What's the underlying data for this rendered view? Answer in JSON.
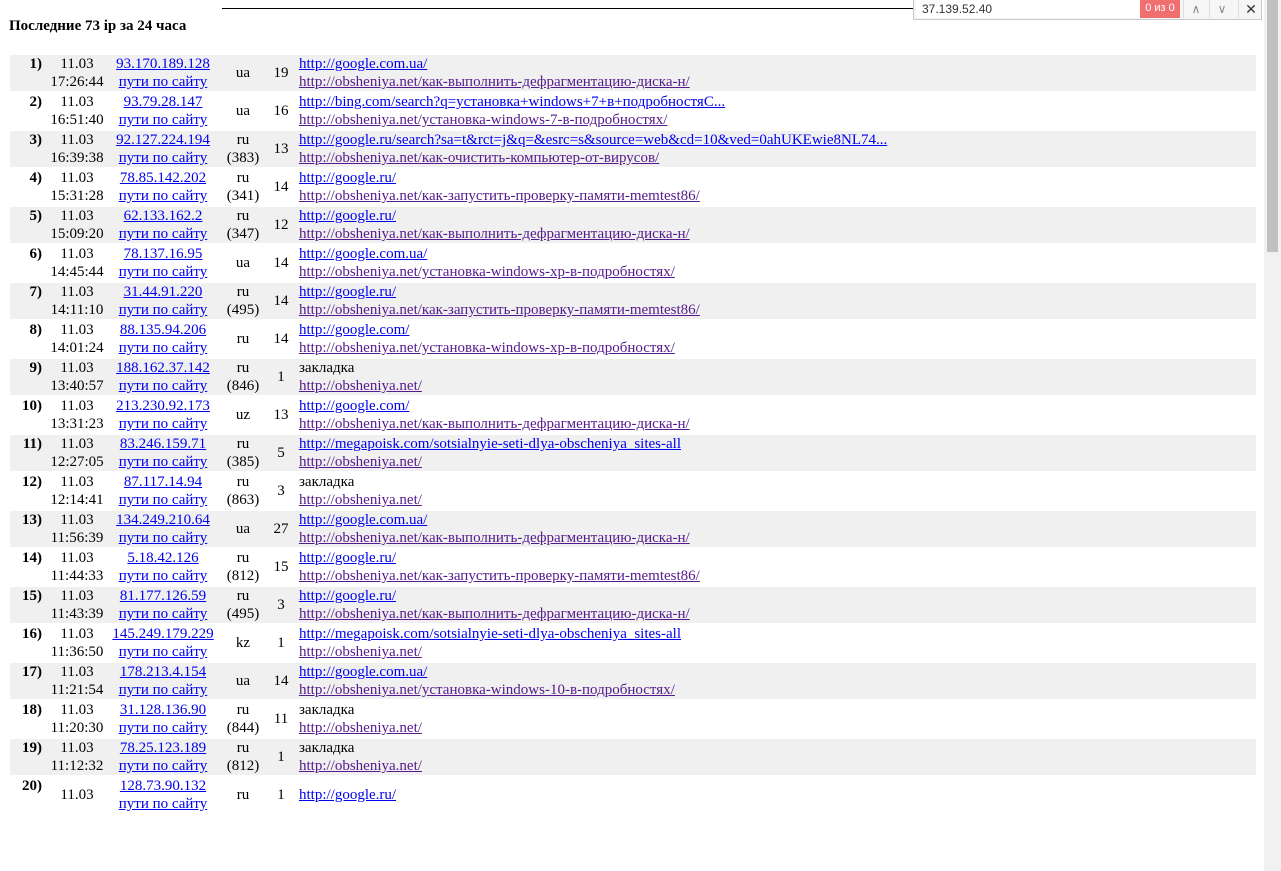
{
  "heading": "Последние 73 ip за 24 часа",
  "find": {
    "query": "37.139.52.40",
    "count": "0 из 0",
    "prev_icon": "chevron-up-icon",
    "next_icon": "chevron-down-icon",
    "close_icon": "close-icon"
  },
  "path_link_label": "пути по сайту",
  "rows": [
    {
      "num": "1)",
      "date": "11.03",
      "time": "17:26:44",
      "ip": "93.170.189.128",
      "cc": "ua",
      "code": "",
      "visits": "19",
      "src": "http://google.com.ua/",
      "page": "http://obsheniya.net/как-выполнить-дефрагментацию-диска-н/"
    },
    {
      "num": "2)",
      "date": "11.03",
      "time": "16:51:40",
      "ip": "93.79.28.147",
      "cc": "ua",
      "code": "",
      "visits": "16",
      "src": "http://bing.com/search?q=установка+windows+7+в+подробностяС...",
      "page": "http://obsheniya.net/установка-windows-7-в-подробностях/"
    },
    {
      "num": "3)",
      "date": "11.03",
      "time": "16:39:38",
      "ip": "92.127.224.194",
      "cc": "ru",
      "code": "(383)",
      "visits": "13",
      "src": "http://google.ru/search?sa=t&rct=j&q=&esrc=s&source=web&cd=10&ved=0ahUKEwie8NL74...",
      "page": "http://obsheniya.net/как-очистить-компьютер-от-вирусов/"
    },
    {
      "num": "4)",
      "date": "11.03",
      "time": "15:31:28",
      "ip": "78.85.142.202",
      "cc": "ru",
      "code": "(341)",
      "visits": "14",
      "src": "http://google.ru/",
      "page": "http://obsheniya.net/как-запустить-проверку-памяти-memtest86/"
    },
    {
      "num": "5)",
      "date": "11.03",
      "time": "15:09:20",
      "ip": "62.133.162.2",
      "cc": "ru",
      "code": "(347)",
      "visits": "12",
      "src": "http://google.ru/",
      "page": "http://obsheniya.net/как-выполнить-дефрагментацию-диска-н/"
    },
    {
      "num": "6)",
      "date": "11.03",
      "time": "14:45:44",
      "ip": "78.137.16.95",
      "cc": "ua",
      "code": "",
      "visits": "14",
      "src": "http://google.com.ua/",
      "page": "http://obsheniya.net/установка-windows-xp-в-подробностях/"
    },
    {
      "num": "7)",
      "date": "11.03",
      "time": "14:11:10",
      "ip": "31.44.91.220",
      "cc": "ru",
      "code": "(495)",
      "visits": "14",
      "src": "http://google.ru/",
      "page": "http://obsheniya.net/как-запустить-проверку-памяти-memtest86/"
    },
    {
      "num": "8)",
      "date": "11.03",
      "time": "14:01:24",
      "ip": "88.135.94.206",
      "cc": "ru",
      "code": "",
      "visits": "14",
      "src": "http://google.com/",
      "page": "http://obsheniya.net/установка-windows-xp-в-подробностях/"
    },
    {
      "num": "9)",
      "date": "11.03",
      "time": "13:40:57",
      "ip": "188.162.37.142",
      "cc": "ru",
      "code": "(846)",
      "visits": "1",
      "src": "закладка",
      "page": "http://obsheniya.net/"
    },
    {
      "num": "10)",
      "date": "11.03",
      "time": "13:31:23",
      "ip": "213.230.92.173",
      "cc": "uz",
      "code": "",
      "visits": "13",
      "src": "http://google.com/",
      "page": "http://obsheniya.net/как-выполнить-дефрагментацию-диска-н/"
    },
    {
      "num": "11)",
      "date": "11.03",
      "time": "12:27:05",
      "ip": "83.246.159.71",
      "cc": "ru",
      "code": "(385)",
      "visits": "5",
      "src": "http://megapoisk.com/sotsialnyie-seti-dlya-obscheniya_sites-all",
      "page": "http://obsheniya.net/"
    },
    {
      "num": "12)",
      "date": "11.03",
      "time": "12:14:41",
      "ip": "87.117.14.94",
      "cc": "ru",
      "code": "(863)",
      "visits": "3",
      "src": "закладка",
      "page": "http://obsheniya.net/"
    },
    {
      "num": "13)",
      "date": "11.03",
      "time": "11:56:39",
      "ip": "134.249.210.64",
      "cc": "ua",
      "code": "",
      "visits": "27",
      "src": "http://google.com.ua/",
      "page": "http://obsheniya.net/как-выполнить-дефрагментацию-диска-н/"
    },
    {
      "num": "14)",
      "date": "11.03",
      "time": "11:44:33",
      "ip": "5.18.42.126",
      "cc": "ru",
      "code": "(812)",
      "visits": "15",
      "src": "http://google.ru/",
      "page": "http://obsheniya.net/как-запустить-проверку-памяти-memtest86/"
    },
    {
      "num": "15)",
      "date": "11.03",
      "time": "11:43:39",
      "ip": "81.177.126.59",
      "cc": "ru",
      "code": "(495)",
      "visits": "3",
      "src": "http://google.ru/",
      "page": "http://obsheniya.net/как-выполнить-дефрагментацию-диска-н/"
    },
    {
      "num": "16)",
      "date": "11.03",
      "time": "11:36:50",
      "ip": "145.249.179.229",
      "cc": "kz",
      "code": "",
      "visits": "1",
      "src": "http://megapoisk.com/sotsialnyie-seti-dlya-obscheniya_sites-all",
      "page": "http://obsheniya.net/"
    },
    {
      "num": "17)",
      "date": "11.03",
      "time": "11:21:54",
      "ip": "178.213.4.154",
      "cc": "ua",
      "code": "",
      "visits": "14",
      "src": "http://google.com.ua/",
      "page": "http://obsheniya.net/установка-windows-10-в-подробностях/"
    },
    {
      "num": "18)",
      "date": "11.03",
      "time": "11:20:30",
      "ip": "31.128.136.90",
      "cc": "ru",
      "code": "(844)",
      "visits": "11",
      "src": "закладка",
      "page": "http://obsheniya.net/"
    },
    {
      "num": "19)",
      "date": "11.03",
      "time": "11:12:32",
      "ip": "78.25.123.189",
      "cc": "ru",
      "code": "(812)",
      "visits": "1",
      "src": "закладка",
      "page": "http://obsheniya.net/"
    },
    {
      "num": "20)",
      "date": "11.03",
      "time": "",
      "ip": "128.73.90.132",
      "cc": "ru",
      "code": "",
      "visits": "1",
      "src": "http://google.ru/",
      "page": ""
    }
  ]
}
